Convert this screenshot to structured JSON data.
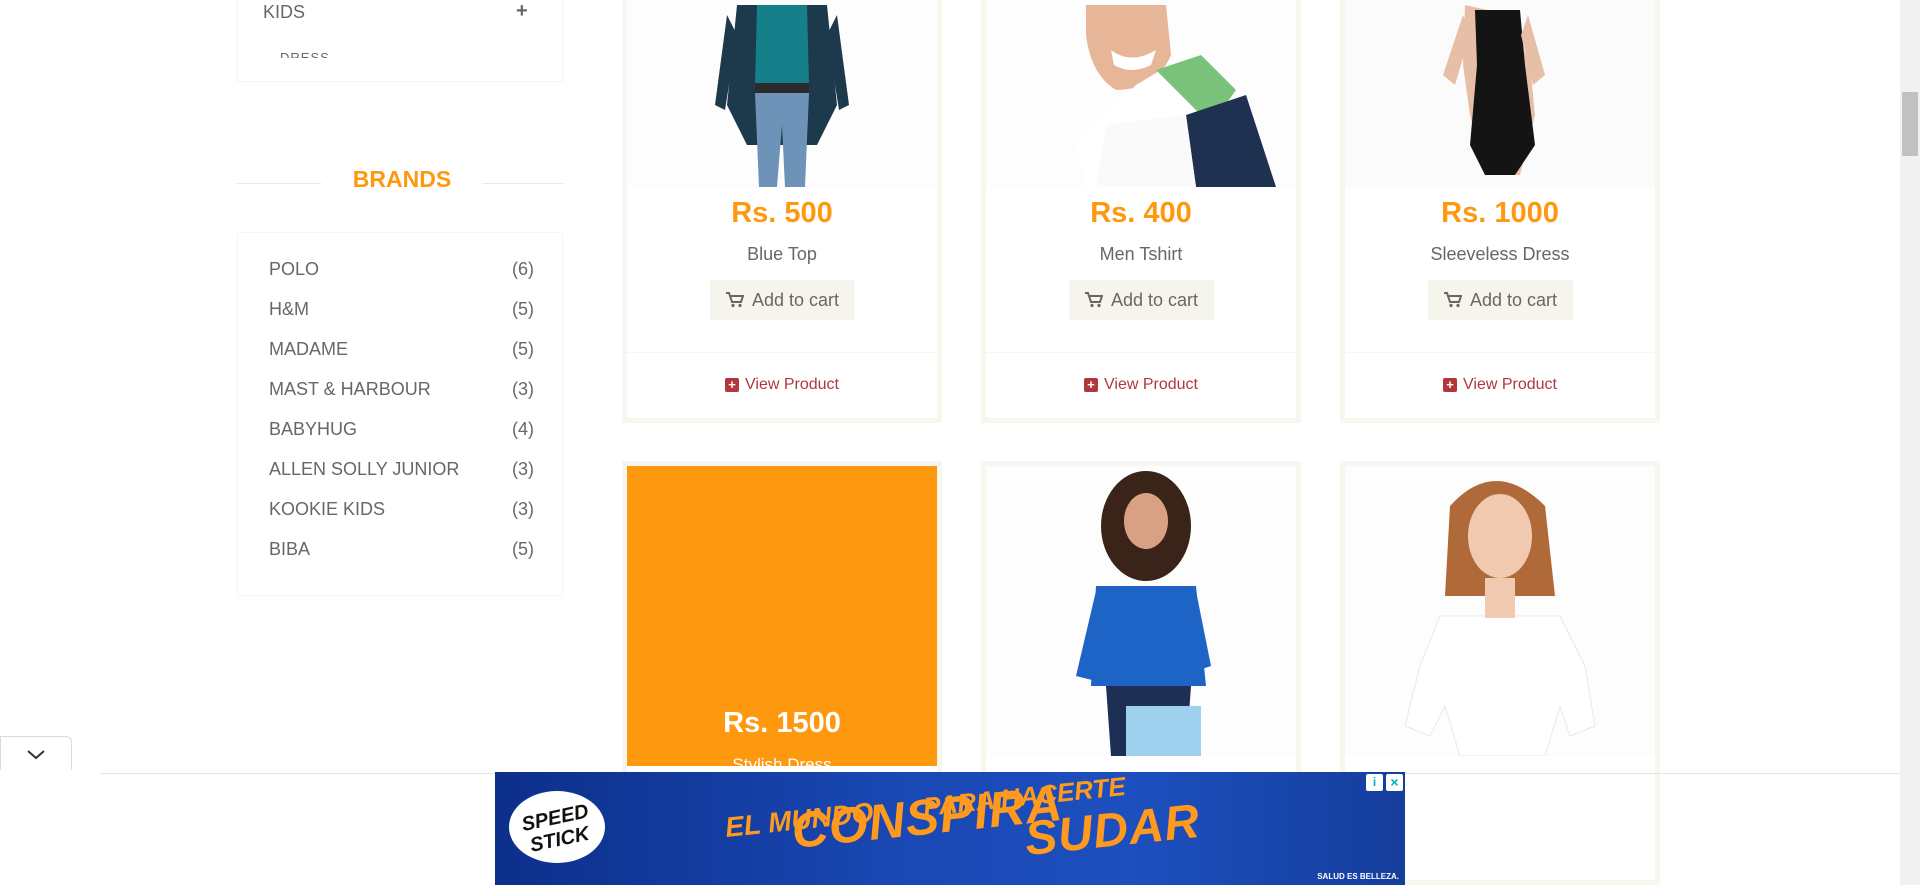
{
  "sidebar": {
    "category": {
      "label": "KIDS",
      "toggle": "+",
      "sub_label": "DRESS"
    },
    "brands_title": "BRANDS",
    "brands": [
      {
        "name": "POLO",
        "count": "(6)"
      },
      {
        "name": "H&M",
        "count": "(5)"
      },
      {
        "name": "MADAME",
        "count": "(5)"
      },
      {
        "name": "MAST & HARBOUR",
        "count": "(3)"
      },
      {
        "name": "BABYHUG",
        "count": "(4)"
      },
      {
        "name": "ALLEN SOLLY JUNIOR",
        "count": "(3)"
      },
      {
        "name": "KOOKIE KIDS",
        "count": "(3)"
      },
      {
        "name": "BIBA",
        "count": "(5)"
      }
    ]
  },
  "products": [
    {
      "price": "Rs. 500",
      "name": "Blue Top",
      "cart_label": "Add to cart",
      "view_label": "View Product"
    },
    {
      "price": "Rs. 400",
      "name": "Men Tshirt",
      "cart_label": "Add to cart",
      "view_label": "View Product"
    },
    {
      "price": "Rs. 1000",
      "name": "Sleeveless Dress",
      "cart_label": "Add to cart",
      "view_label": "View Product"
    },
    {
      "price": "Rs. 1500",
      "name": "Stylish Dress"
    }
  ],
  "ad": {
    "brand": "SPEED STICK",
    "line1": "EL MUNDO",
    "line2": "CONSPIRA",
    "line3": "PARA HACERTE",
    "line4": "SUDAR",
    "tagline": "SALUD ES BELLEZA.",
    "info_icon": "info-icon",
    "close_icon": "close-icon"
  },
  "colors": {
    "accent": "#FE980F",
    "link": "#B2373C",
    "text": "#696763",
    "button_bg": "#F5F5ED",
    "ad_bg": "#1a48b4"
  }
}
